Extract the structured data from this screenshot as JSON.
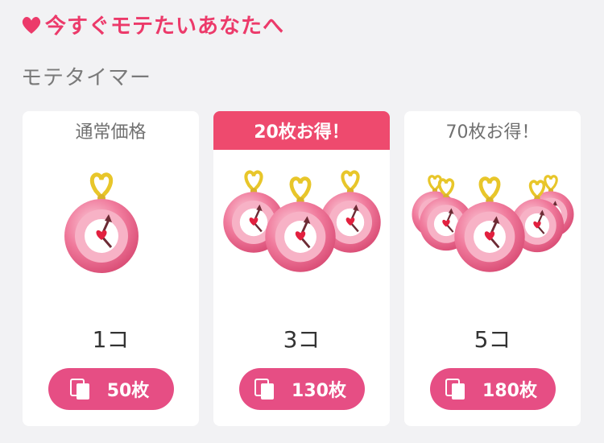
{
  "header": {
    "title": "今すぐモテたいあなたへ",
    "subtitle": "モテタイマー"
  },
  "colors": {
    "accent": "#ec3a6a",
    "button": "#e64e84",
    "badge": "#ee4a6e",
    "background": "#f2f2f4"
  },
  "plans": [
    {
      "label": "通常価格",
      "quantity": "1コ",
      "price": "50枚",
      "icon": "coin-icon"
    },
    {
      "label": "20枚お得！",
      "quantity": "3コ",
      "price": "130枚",
      "icon": "coin-icon"
    },
    {
      "label": "70枚お得！",
      "quantity": "5コ",
      "price": "180枚",
      "icon": "coin-icon"
    }
  ]
}
